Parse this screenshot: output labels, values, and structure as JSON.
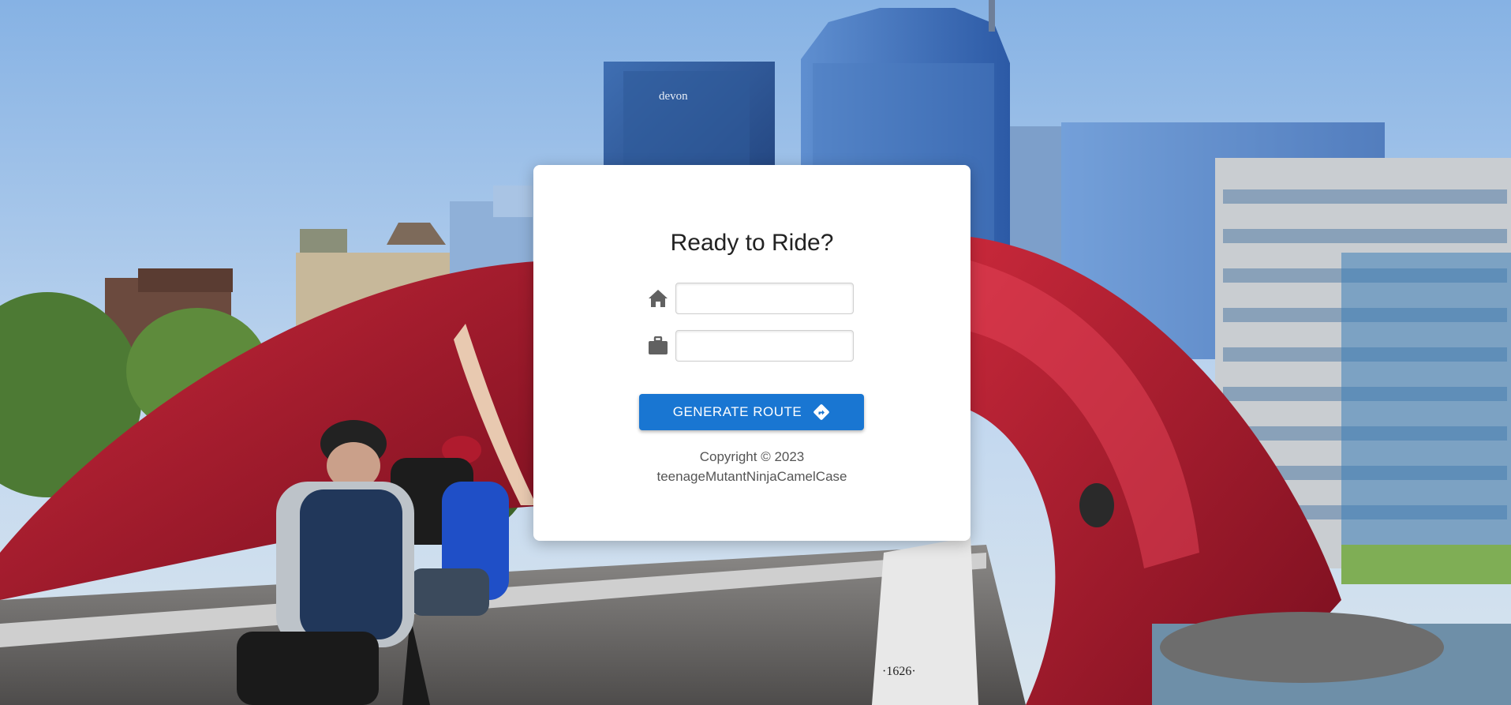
{
  "card": {
    "title": "Ready to Ride?",
    "home_input": {
      "value": "",
      "placeholder": ""
    },
    "work_input": {
      "value": "",
      "placeholder": ""
    },
    "home_icon": "home-icon",
    "work_icon": "briefcase-icon",
    "button": {
      "label": "GENERATE ROUTE",
      "icon": "directions-icon",
      "color": "#1976d2"
    },
    "copyright_line1": "Copyright © 2023",
    "copyright_line2": "teenageMutantNinjaCamelCase"
  },
  "background": {
    "building_sign": "devon",
    "bridge_plaque": "1626"
  }
}
